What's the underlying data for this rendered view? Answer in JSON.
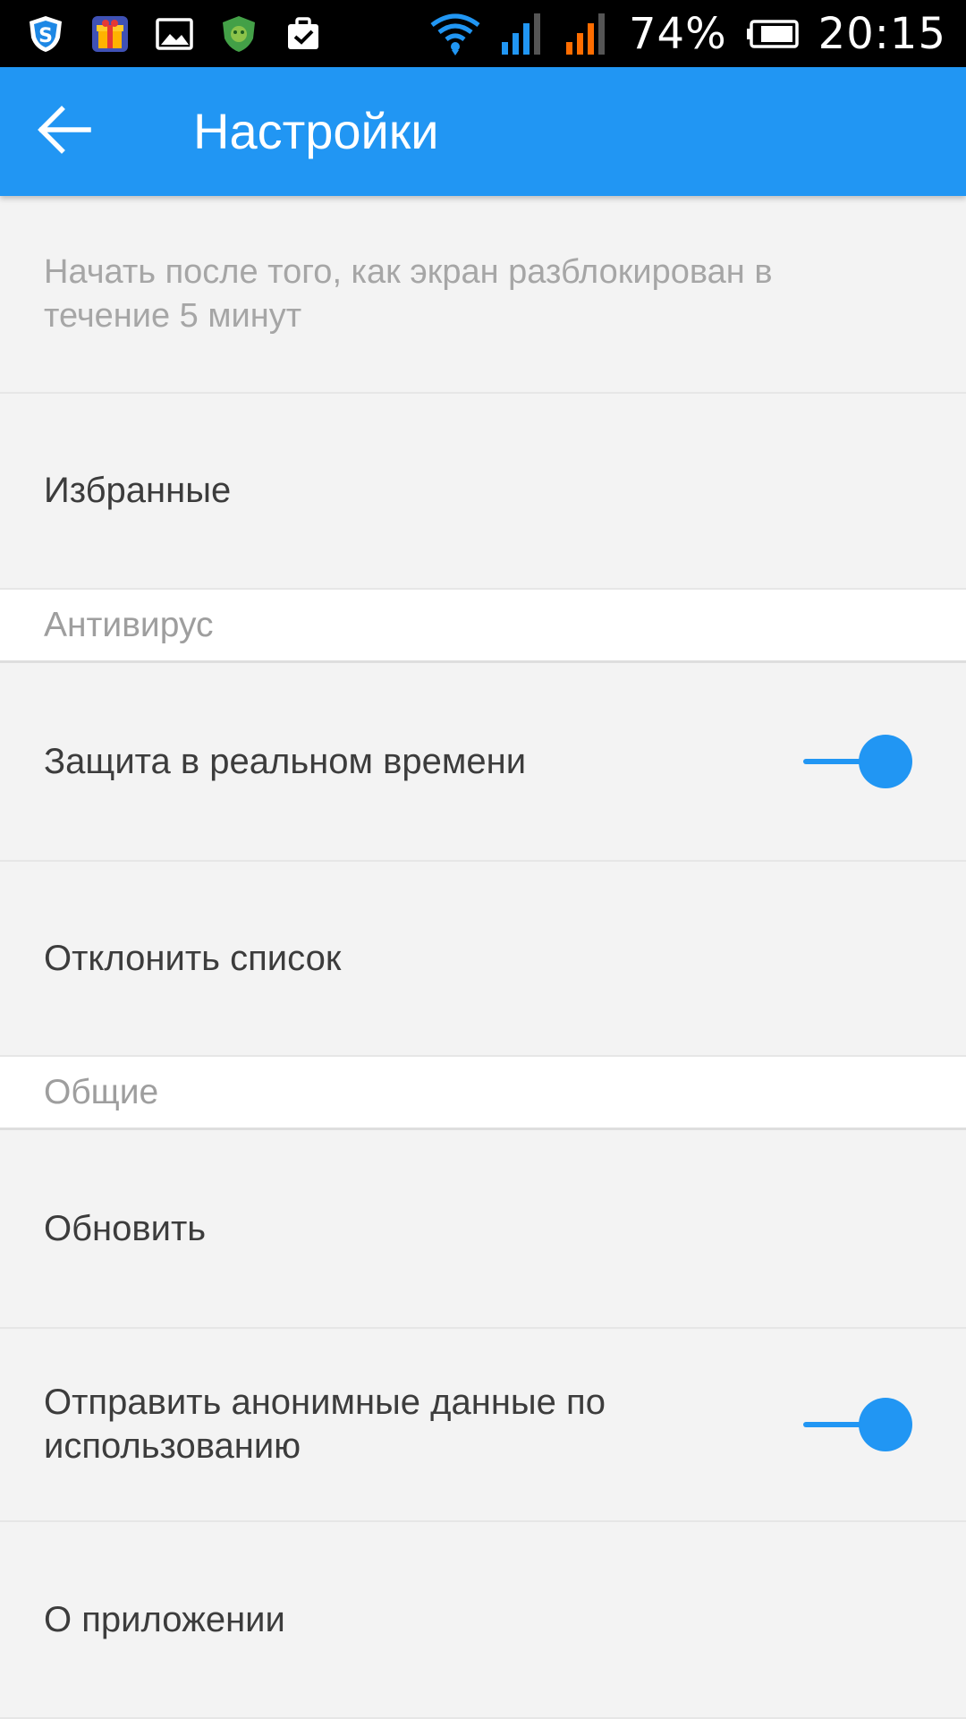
{
  "status_bar": {
    "battery": "74%",
    "time": "20:15",
    "left_icons": [
      "shield-app-icon",
      "gift-icon",
      "image-icon",
      "antivirus-icon",
      "clipboard-check-icon"
    ],
    "right_icons": [
      "wifi-icon",
      "signal-blue-icon",
      "signal-orange-icon",
      "battery-icon"
    ]
  },
  "appbar": {
    "title": "Настройки",
    "back_icon": "arrow-back-icon"
  },
  "settings": {
    "unlock_description": "Начать после того, как экран разблокирован в течение 5 минут",
    "favorites": "Избранные",
    "antivirus_section": "Антивирус",
    "realtime_protection": "Защита в реальном времени",
    "realtime_protection_enabled": true,
    "reject_list": "Отклонить список",
    "general_section": "Общие",
    "update": "Обновить",
    "send_anonymous_data": "Отправить анонимные данные по использованию",
    "send_anonymous_data_enabled": true,
    "about": "О приложении"
  },
  "colors": {
    "accent": "#2196f3",
    "background": "#f3f3f3",
    "section_background": "#ffffff",
    "primary_text": "#3c3c3c",
    "secondary_text": "#a6a6a6",
    "signal_blue": "#2196f3",
    "signal_orange": "#ff6d00"
  }
}
